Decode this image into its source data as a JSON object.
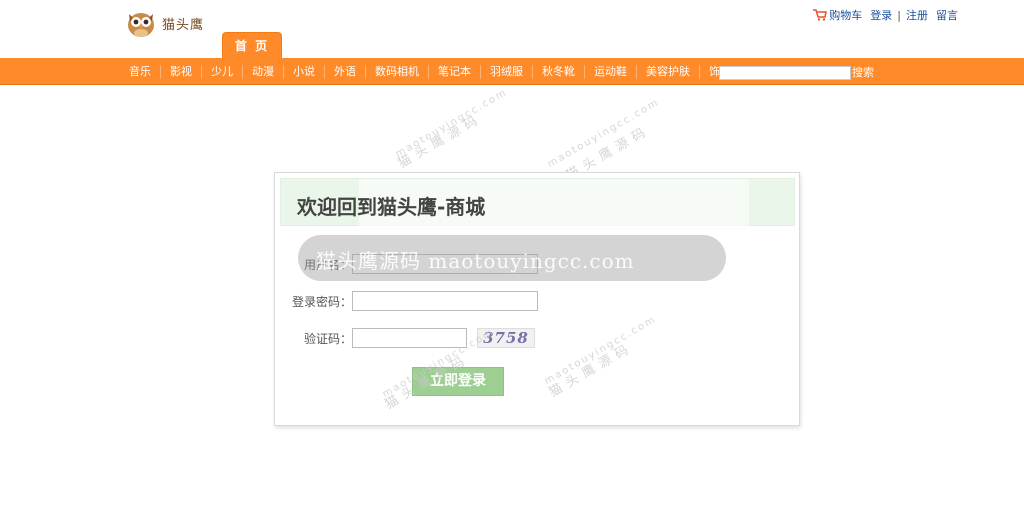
{
  "header": {
    "logo_text": "猫头鹰",
    "cart_label": "购物车",
    "login_link": "登录",
    "separator": "|",
    "register_link": "注册",
    "message_link": "留言"
  },
  "home_tab": "首 页",
  "nav": {
    "items": [
      "音乐",
      "影视",
      "少儿",
      "动漫",
      "小说",
      "外语",
      "数码相机",
      "笔记本",
      "羽绒服",
      "秋冬靴",
      "运动鞋",
      "美容护肤",
      "饰品"
    ],
    "search_value": "",
    "search_button": "搜索"
  },
  "login": {
    "title": "欢迎回到猫头鹰-商城",
    "username_label": "用户名：",
    "password_label": "登录密码：",
    "captcha_label": "验证码：",
    "captcha_text": "3758",
    "submit_label": "立即登录",
    "username_value": "",
    "password_value": "",
    "captcha_value": ""
  },
  "watermark": {
    "banner_text": "猫头鹰源码 maotouyingcc.com",
    "small_text": "maotouyingcc.com",
    "cn_text": "猫头鹰源码"
  },
  "colors": {
    "accent_orange": "#ff8a2a",
    "link_blue": "#1c4f9c",
    "button_green": "#9dcf93",
    "header_green": "#eaf6ea"
  }
}
